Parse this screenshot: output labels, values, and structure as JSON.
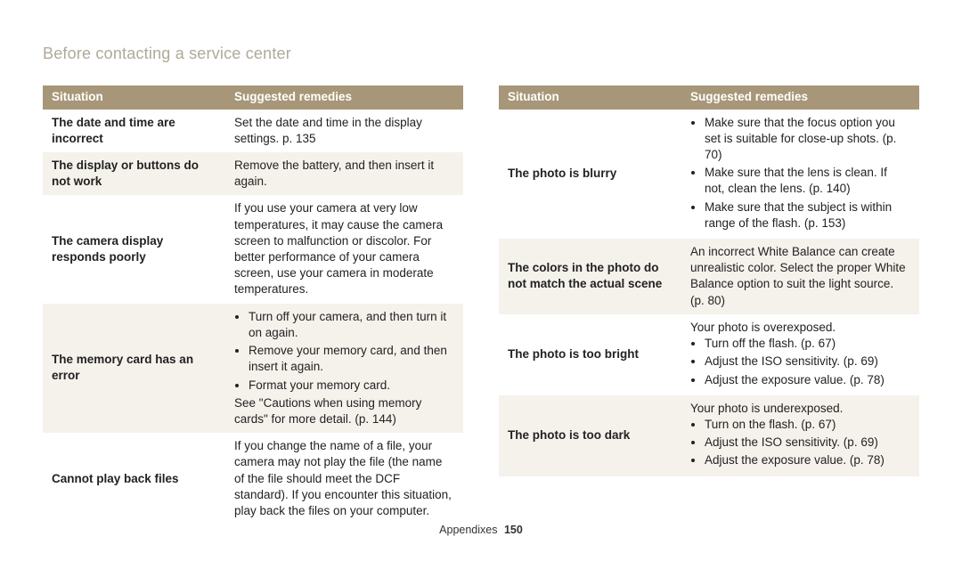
{
  "header": {
    "title": "Before contacting a service center"
  },
  "table_headers": {
    "situation": "Situation",
    "remedies": "Suggested remedies"
  },
  "left_rows": [
    {
      "situation": "The date and time are incorrect",
      "remedy_text": "Set the date and time in the display settings. p. 135",
      "alt": false
    },
    {
      "situation": "The display or buttons do not work",
      "remedy_text": "Remove the battery, and then insert it again.",
      "alt": true
    },
    {
      "situation": "The camera display responds poorly",
      "remedy_text": "If you use your camera at very low temperatures, it may cause the camera screen to malfunction or discolor. For better performance of your camera screen, use your camera in moderate temperatures.",
      "alt": false
    },
    {
      "situation": "The memory card has an error",
      "remedy_bullets": [
        "Turn off your camera, and then turn it on again.",
        "Remove your memory card, and then insert it again.",
        "Format your memory card."
      ],
      "remedy_after": "See \"Cautions when using memory cards\" for more detail. (p. 144)",
      "alt": true
    },
    {
      "situation": "Cannot play back files",
      "remedy_text": "If you change the name of a file, your camera may not play the file (the name of the file should meet the DCF standard). If you encounter this situation, play back the files on your computer.",
      "alt": false
    }
  ],
  "right_rows": [
    {
      "situation": "The photo is blurry",
      "remedy_bullets": [
        "Make sure that the focus option you set is suitable for close-up shots. (p. 70)",
        "Make sure that the lens is clean. If not, clean the lens. (p. 140)",
        "Make sure that the subject is within range of the flash. (p. 153)"
      ],
      "alt": false
    },
    {
      "situation": "The colors in the photo do not match the actual scene",
      "remedy_text": "An incorrect White Balance can create unrealistic color. Select the proper White Balance option to suit the light source. (p. 80)",
      "alt": true
    },
    {
      "situation": "The photo is too bright",
      "remedy_lead": "Your photo is overexposed.",
      "remedy_bullets": [
        "Turn off the flash. (p. 67)",
        "Adjust the ISO sensitivity. (p. 69)",
        "Adjust the exposure value. (p. 78)"
      ],
      "alt": false
    },
    {
      "situation": "The photo is too dark",
      "remedy_lead": "Your photo is underexposed.",
      "remedy_bullets": [
        "Turn on the flash. (p. 67)",
        "Adjust the ISO sensitivity. (p. 69)",
        "Adjust the exposure value. (p. 78)"
      ],
      "alt": true
    }
  ],
  "footer": {
    "section": "Appendixes",
    "page": "150"
  }
}
